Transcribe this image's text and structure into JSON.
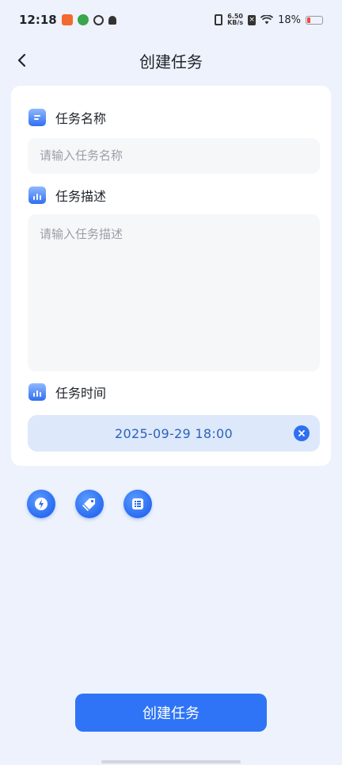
{
  "status_bar": {
    "time": "12:18",
    "net_speed_value": "6.50",
    "net_speed_unit": "KB/s",
    "battery": "18%"
  },
  "header": {
    "title": "创建任务"
  },
  "form": {
    "name_label": "任务名称",
    "name_placeholder": "请输入任务名称",
    "desc_label": "任务描述",
    "desc_placeholder": "请输入任务描述",
    "time_label": "任务时间",
    "time_value": "2025-09-29 18:00"
  },
  "toolbar": {
    "icons": [
      "lightning-icon",
      "tag-icon",
      "list-icon"
    ]
  },
  "submit_label": "创建任务",
  "colors": {
    "background": "#eef2fc",
    "accent": "#2f74f6",
    "time_box": "#dde8fb",
    "time_text": "#2c63b8"
  }
}
